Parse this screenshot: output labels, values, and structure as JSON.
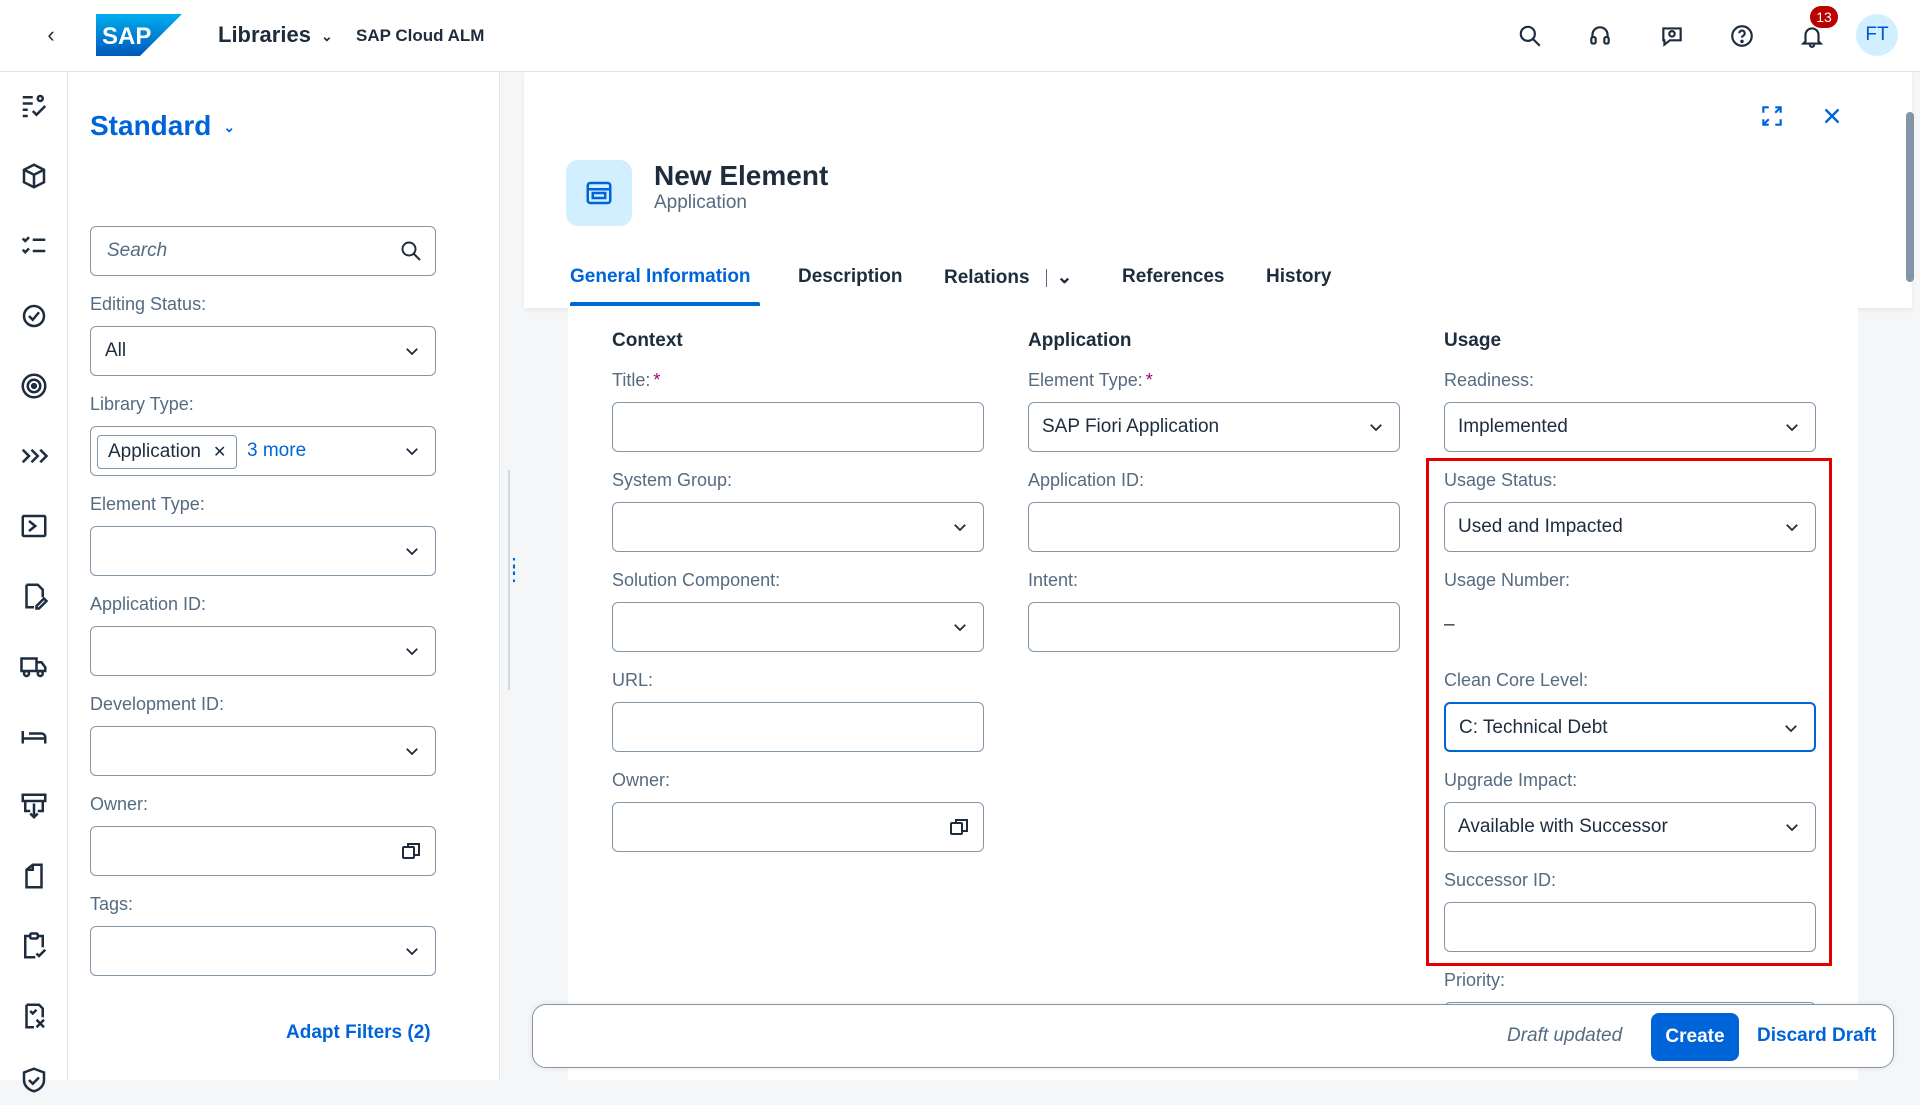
{
  "shell": {
    "app_title": "Libraries",
    "product": "SAP Cloud ALM",
    "notification_count": "13",
    "avatar_initials": "FT",
    "icons": [
      "back-icon",
      "search-icon",
      "headset-icon",
      "feedback-icon",
      "help-icon",
      "bell-icon"
    ]
  },
  "leftnav": {
    "icons": [
      "overview-icon",
      "package-icon",
      "tasks-icon",
      "quality-icon",
      "target-icon",
      "forward-icon",
      "process-icon",
      "edit-icon",
      "delivery-icon",
      "bed-icon",
      "download-icon",
      "document-icon",
      "clipboard-check-icon",
      "formula-icon",
      "shield-icon"
    ]
  },
  "filters": {
    "variant": "Standard",
    "search_placeholder": "Search",
    "editing_status_label": "Editing Status:",
    "editing_status_value": "All",
    "library_type_label": "Library Type:",
    "library_type_token": "Application",
    "library_type_more": "3 more",
    "element_type_label": "Element Type:",
    "application_id_label": "Application ID:",
    "development_id_label": "Development ID:",
    "owner_label": "Owner:",
    "tags_label": "Tags:",
    "adapt_filters": "Adapt Filters (2)"
  },
  "object": {
    "title": "New Element",
    "subtitle": "Application",
    "tabs": [
      "General Information",
      "Description",
      "Relations",
      "References",
      "History"
    ],
    "active_tab": "General Information"
  },
  "form": {
    "context": {
      "heading": "Context",
      "title_label": "Title:",
      "system_group_label": "System Group:",
      "solution_component_label": "Solution Component:",
      "url_label": "URL:",
      "owner_label": "Owner:"
    },
    "application": {
      "heading": "Application",
      "element_type_label": "Element Type:",
      "element_type_value": "SAP Fiori Application",
      "application_id_label": "Application ID:",
      "intent_label": "Intent:"
    },
    "usage": {
      "heading": "Usage",
      "readiness_label": "Readiness:",
      "readiness_value": "Implemented",
      "usage_status_label": "Usage Status:",
      "usage_status_value": "Used and Impacted",
      "usage_number_label": "Usage Number:",
      "usage_number_value": "–",
      "clean_core_label": "Clean Core Level:",
      "clean_core_value": "C: Technical Debt",
      "upgrade_impact_label": "Upgrade Impact:",
      "upgrade_impact_value": "Available with Successor",
      "successor_id_label": "Successor ID:",
      "priority_label": "Priority:"
    }
  },
  "footer": {
    "status": "Draft updated",
    "create": "Create",
    "discard": "Discard Draft"
  },
  "colors": {
    "brand": "#0064d9",
    "highlight_box": "#e30000",
    "badge": "#bb0000"
  }
}
